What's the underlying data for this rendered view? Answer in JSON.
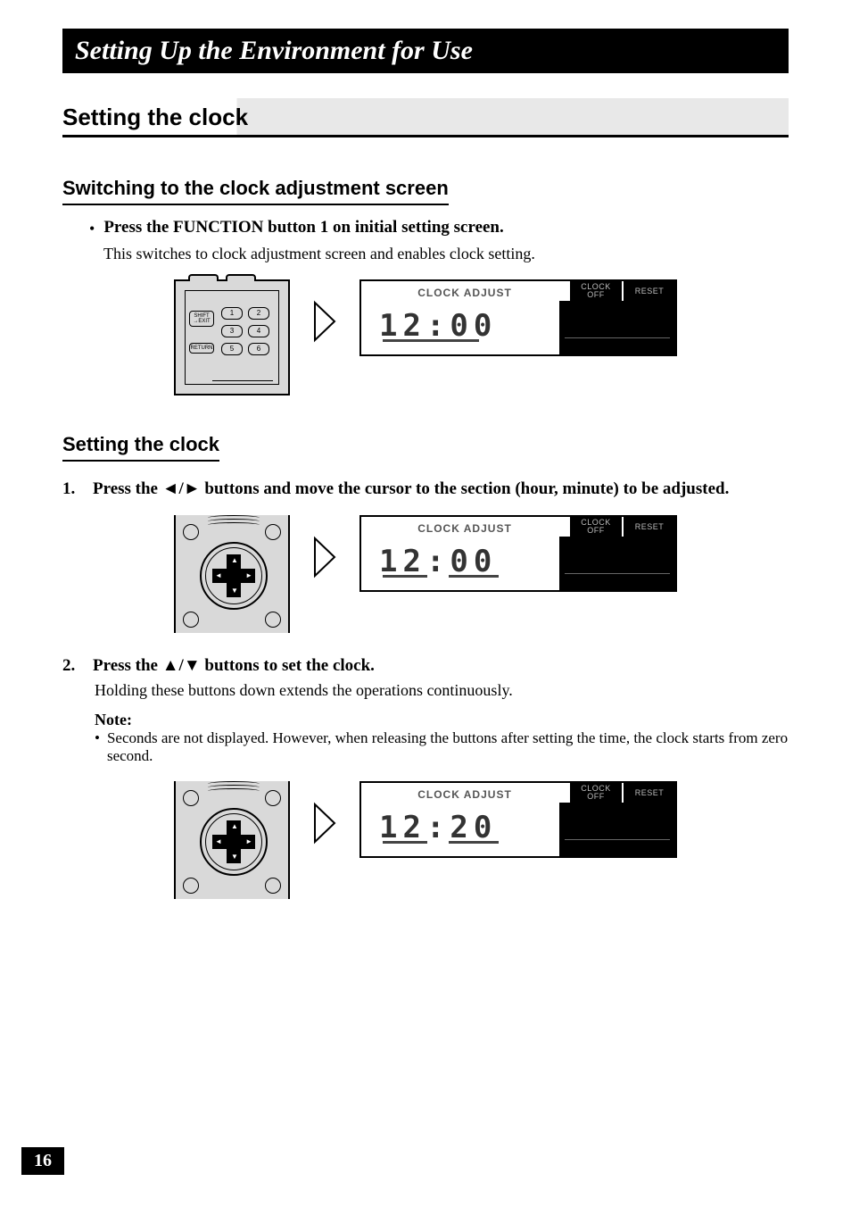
{
  "chapter_title": "Setting Up the Environment for Use",
  "section_title": "Setting the clock",
  "sub1": {
    "title": "Switching to the clock adjustment screen",
    "bullet": "Press the FUNCTION button 1 on initial setting screen.",
    "desc": "This switches to clock adjustment screen and enables clock setting."
  },
  "sub2": {
    "title": "Setting the clock",
    "step1_num": "1.",
    "step1": "Press the ◄/► buttons and move the cursor to the section (hour, minute) to be adjusted.",
    "step2_num": "2.",
    "step2": "Press the ▲/▼ buttons to set the clock.",
    "step2_desc": "Holding these buttons down extends the operations continuously.",
    "note_label": "Note:",
    "note_bullet": "•",
    "note_text": "Seconds are not displayed. However, when releasing the buttons after setting the time, the clock starts from zero second."
  },
  "keypad": {
    "shift": "SHIFT\n→EXIT",
    "return": "RETURN",
    "keys": [
      "1",
      "2",
      "3",
      "4",
      "5",
      "6"
    ]
  },
  "lcd": {
    "label": "CLOCK ADJUST",
    "btn_clock": "CLOCK\nOFF",
    "btn_reset": "RESET",
    "time1": "12:00",
    "time2": "12:00",
    "time3": "12:20"
  },
  "bullet_char": "•",
  "page_number": "16"
}
